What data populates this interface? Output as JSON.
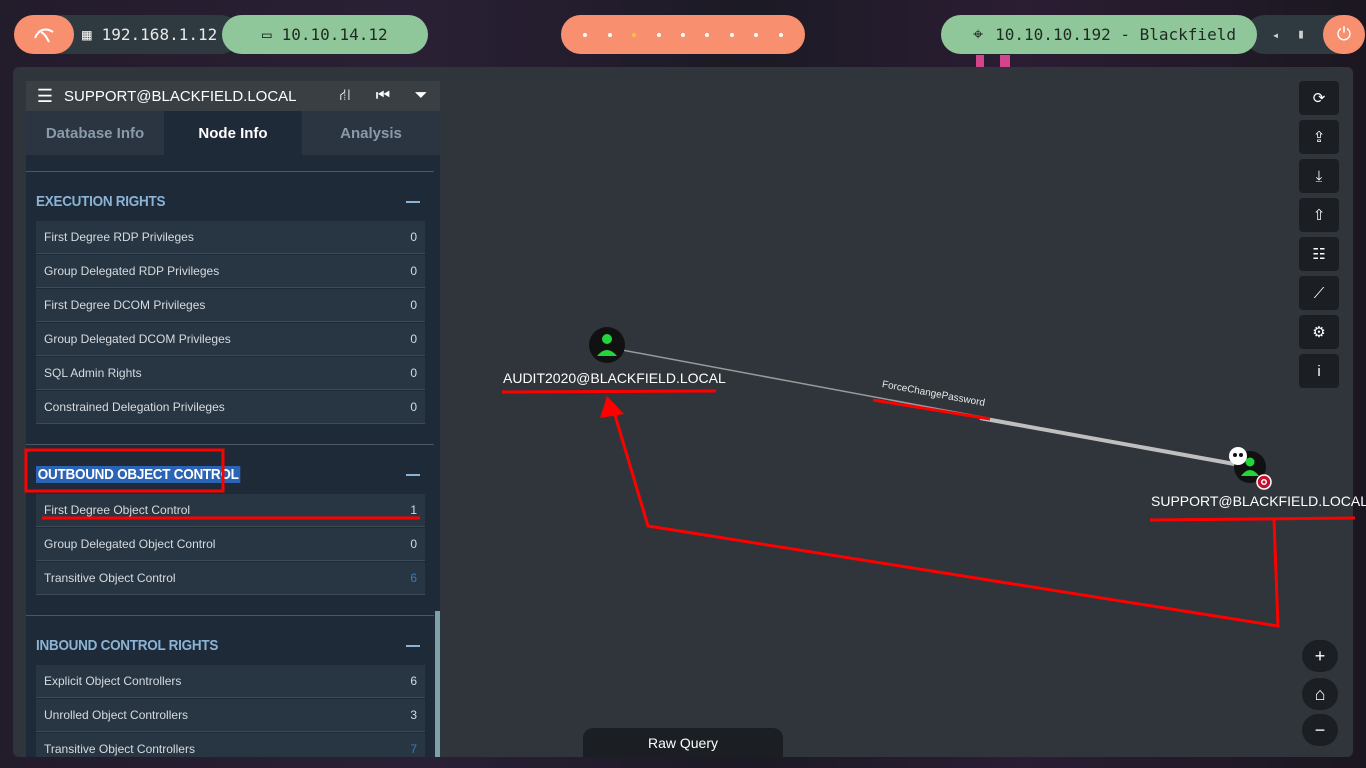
{
  "topbar": {
    "local_ip": "192.168.1.12",
    "vpn_ip": "10.10.14.12",
    "target": "10.10.10.192 - Blackfield"
  },
  "sidebar": {
    "header_title": "SUPPORT@BLACKFIELD.LOCAL",
    "tabs": [
      {
        "label": "Database Info"
      },
      {
        "label": "Node Info"
      },
      {
        "label": "Analysis"
      }
    ],
    "execution_rights": {
      "title": "EXECUTION RIGHTS",
      "rows": [
        {
          "label": "First Degree RDP Privileges",
          "value": "0"
        },
        {
          "label": "Group Delegated RDP Privileges",
          "value": "0"
        },
        {
          "label": "First Degree DCOM Privileges",
          "value": "0"
        },
        {
          "label": "Group Delegated DCOM Privileges",
          "value": "0"
        },
        {
          "label": "SQL Admin Rights",
          "value": "0"
        },
        {
          "label": "Constrained Delegation Privileges",
          "value": "0"
        }
      ]
    },
    "outbound_control": {
      "title": "OUTBOUND OBJECT CONTROL",
      "rows": [
        {
          "label": "First Degree Object Control",
          "value": "1"
        },
        {
          "label": "Group Delegated Object Control",
          "value": "0"
        },
        {
          "label": "Transitive Object Control",
          "value": "6"
        }
      ]
    },
    "inbound_control": {
      "title": "INBOUND CONTROL RIGHTS",
      "rows": [
        {
          "label": "Explicit Object Controllers",
          "value": "6"
        },
        {
          "label": "Unrolled Object Controllers",
          "value": "3"
        },
        {
          "label": "Transitive Object Controllers",
          "value": "7"
        }
      ]
    }
  },
  "graph": {
    "source_node": "AUDIT2020@BLACKFIELD.LOCAL",
    "target_node": "SUPPORT@BLACKFIELD.LOCAL",
    "edge_label": "ForceChangePassword"
  },
  "raw_query": "Raw Query",
  "colors": {
    "accent": "#f88f6f",
    "green": "#8fc79a",
    "annotation": "#ff0000"
  }
}
